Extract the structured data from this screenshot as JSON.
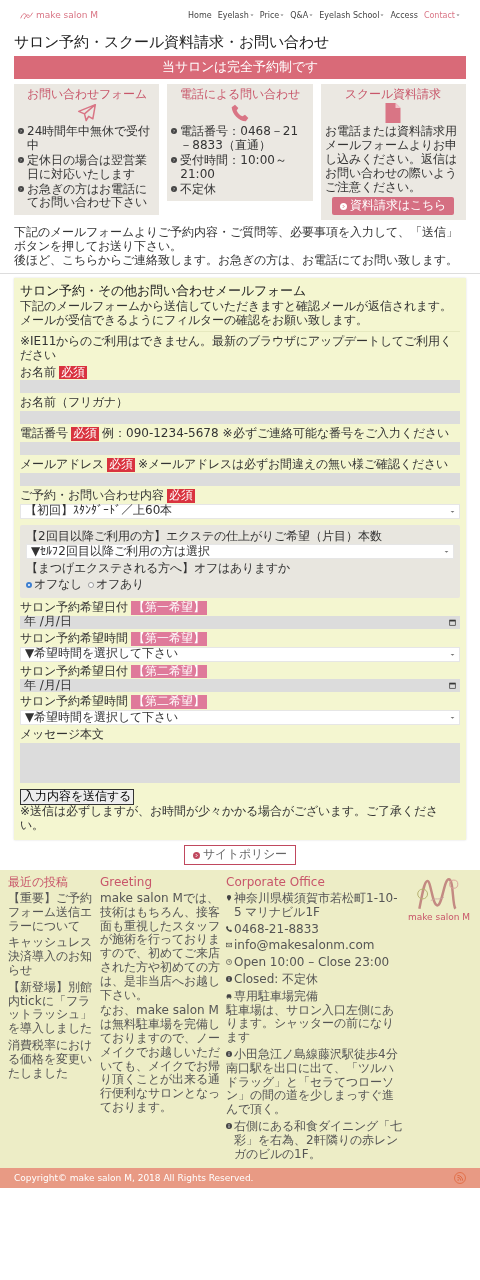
{
  "header": {
    "logo_text": "make salon M",
    "nav": [
      {
        "label": "Home",
        "has_menu": false,
        "selected": false
      },
      {
        "label": "Eyelash",
        "has_menu": true,
        "selected": false
      },
      {
        "label": "Price",
        "has_menu": true,
        "selected": false
      },
      {
        "label": "Q&A",
        "has_menu": true,
        "selected": false
      },
      {
        "label": "Eyelash School",
        "has_menu": true,
        "selected": false
      },
      {
        "label": "Access",
        "has_menu": false,
        "selected": false
      },
      {
        "label": "Contact",
        "has_menu": true,
        "selected": true
      }
    ]
  },
  "page_title": "サロン予約・スクール資料請求・お問い合わせ",
  "banner": "当サロンは完全予約制です",
  "cards": [
    {
      "kind": "form",
      "title": "お問い合わせフォーム",
      "items": [
        "24時間年中無休で受付中",
        "定休日の場合は翌営業日に対応いたします",
        "お急ぎの方はお電話にてお問い合わせ下さい"
      ]
    },
    {
      "kind": "phone",
      "title": "電話による問い合わせ",
      "items": [
        "電話番号：0468－21－8833（直通）",
        "受付時間：10:00～21:00",
        "不定休"
      ]
    },
    {
      "kind": "document",
      "title": "スクール資料請求",
      "text": "お電話または資料請求用メールフォームよりお申し込みください。返信はお問い合わせの際いようご注意ください。",
      "button": "資料請求はこちら"
    }
  ],
  "intro": [
    "下記のメールフォームよりご予約内容・ご質問等、必要事項を入力して、「送信」ボタンを押してお送り下さい。",
    "後ほど、こちらからご連絡致します。お急ぎの方は、お電話にてお問い致します。"
  ],
  "form": {
    "title": "サロン予約・その他お問い合わせメールフォーム",
    "subtitle": "下記のメールフォームから送信していただきますと確認メールが返信されます。メールが受信できるようにフィルターの確認をお願い致します。",
    "notice": "※IE11からのご利用はできません。最新のブラウザにアップデートしてご利用ください",
    "fields": [
      {
        "kind": "text",
        "label": "お名前",
        "badge": {
          "kind": "required",
          "text": "必須"
        }
      },
      {
        "kind": "text",
        "label": "お名前（フリガナ）"
      },
      {
        "kind": "text",
        "label": "電話番号",
        "badge": {
          "kind": "required",
          "text": "必須"
        },
        "hint": "例：090-1234-5678 ※必ずご連絡可能な番号をご入力ください"
      },
      {
        "kind": "text",
        "label": "メールアドレス",
        "badge": {
          "kind": "required",
          "text": "必須"
        },
        "hint": "※メールアドレスは必ずお間違えの無い様ご確認ください"
      },
      {
        "kind": "select",
        "label": "ご予約・お問い合わせ内容",
        "badge": {
          "kind": "required",
          "text": "必須"
        },
        "value": "【初回】ｽﾀﾝﾀﾞｰﾄﾞ／上60本"
      },
      {
        "kind": "group",
        "fields": [
          {
            "kind": "select",
            "label": "【2回目以降ご利用の方】エクステの仕上がりご希望（片目）本数",
            "value": "▼ｾﾙﾌ2回目以降ご利用の方は選択"
          },
          {
            "kind": "radio",
            "label": "【まつげエクステされる方へ】オフはありますか",
            "options": [
              {
                "label": "オフなし",
                "selected": true
              },
              {
                "label": "オフあり",
                "selected": false
              }
            ]
          }
        ]
      },
      {
        "kind": "date",
        "label": "サロン予約希望日付",
        "badge": {
          "kind": "preference",
          "text": "【第一希望】"
        },
        "placeholder": "年 /月/日"
      },
      {
        "kind": "select",
        "label": "サロン予約希望時間",
        "badge": {
          "kind": "preference",
          "text": "【第一希望】"
        },
        "value": "▼希望時間を選択して下さい"
      },
      {
        "kind": "date",
        "label": "サロン予約希望日付",
        "badge": {
          "kind": "preference",
          "text": "【第二希望】"
        },
        "placeholder": "年 /月/日"
      },
      {
        "kind": "select",
        "label": "サロン予約希望時間",
        "badge": {
          "kind": "preference",
          "text": "【第二希望】"
        },
        "value": "▼希望時間を選択して下さい"
      },
      {
        "kind": "textarea",
        "label": "メッセージ本文"
      }
    ],
    "submit": "入力内容を送信する",
    "submit_note": "※送信は必ずしますが、お時間が少々かかる場合がございます。ご了承ください。"
  },
  "policy_button": "サイトポリシー",
  "footer": {
    "columns": [
      {
        "kind": "posts",
        "title": "最近の投稿",
        "items": [
          "【重要】ご予約フォーム送信エラーについて",
          "キャッシュレス決済導入のお知らせ",
          "【新登場】別館内tickに「フラットラッシュ」を導入しました",
          "消費税率における価格を変更いたしました"
        ]
      },
      {
        "kind": "text",
        "title": "Greeting",
        "paragraphs": [
          "make salon Mでは、技術はもちろん、接客面も重視したスタッフが施術を行っておりますので、初めてご来店された方や初めての方は、是非当店へお越し下さい。",
          "なお、make salon Mは無料駐車場を完備しておりますので、ノーメイクでお越しいただいても、メイクでお帰り頂くことが出来る通行便利なサロンとなっております。"
        ]
      },
      {
        "kind": "contact",
        "title": "Corporate Office",
        "items": [
          {
            "kind": "address",
            "text": "神奈川県横須賀市若松町1-10-5 マリナビル1F"
          },
          {
            "kind": "phone",
            "text": "0468-21-8833"
          },
          {
            "kind": "mail",
            "text": "info@makesalonm.com"
          },
          {
            "kind": "hours",
            "text": "Open 10:00 – Close 23:00"
          },
          {
            "kind": "info",
            "text": "Closed: 不定休"
          },
          {
            "kind": "parking",
            "text": "専用駐車場完備",
            "detail": "駐車場は、サロン入口左側にあります。シャッターの前になります"
          },
          {
            "kind": "info",
            "text": "小田急江ノ島線藤沢駅徒歩4分",
            "detail": "南口駅を出口に出て、「ツルハドラッグ」と「セラてつローソン」の間の道を少しまっすぐ進んで頂く。"
          },
          {
            "kind": "info",
            "text": "右側にある和食ダイニング「七彩」を右為、2軒隣りの赤レンガのビルの1F。"
          }
        ]
      },
      {
        "kind": "logo",
        "text": "make salon M"
      }
    ]
  },
  "copyright": "Copyright© make salon M, 2018 All Rights Reserved."
}
